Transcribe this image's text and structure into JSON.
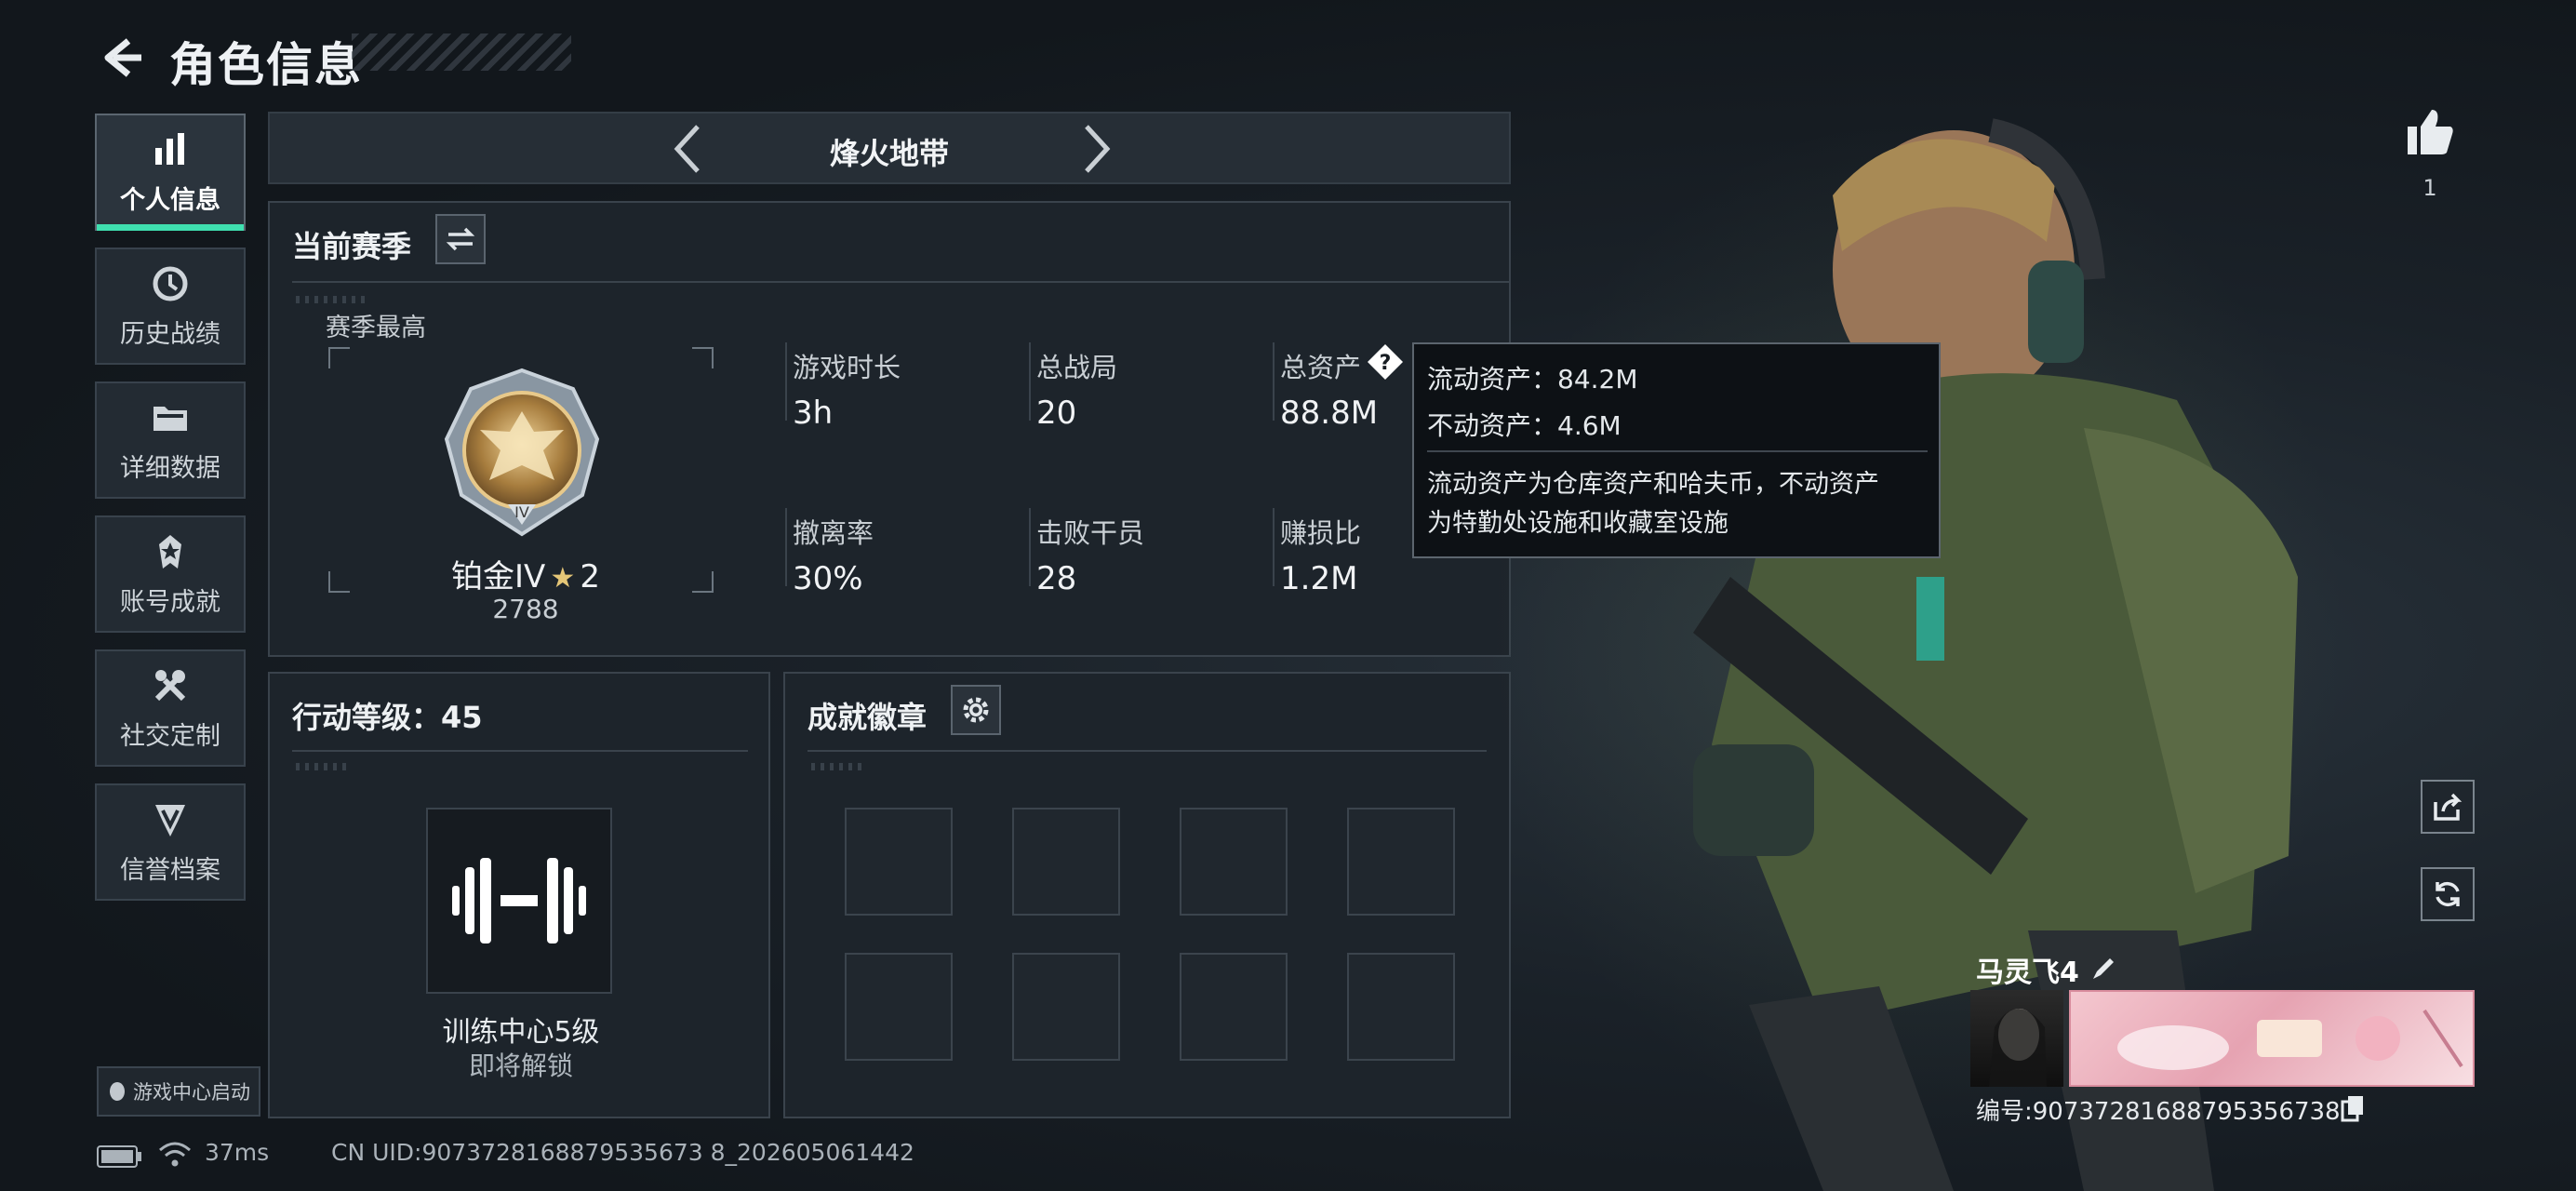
{
  "header": {
    "title": "角色信息"
  },
  "nav": [
    {
      "label": "个人信息",
      "icon": "bar-chart-icon",
      "active": true
    },
    {
      "label": "历史战绩",
      "icon": "history-icon"
    },
    {
      "label": "详细数据",
      "icon": "folder-icon"
    },
    {
      "label": "账号成就",
      "icon": "achievement-icon"
    },
    {
      "label": "社交定制",
      "icon": "tools-icon"
    },
    {
      "label": "信誉档案",
      "icon": "shield-icon"
    }
  ],
  "launch_button": "游戏中心启动",
  "status_bar": {
    "ping": "37ms",
    "uid": "CN UID:9073728168879535673 8_202605061442"
  },
  "map_selector": {
    "name": "烽火地带"
  },
  "season": {
    "title": "当前赛季",
    "best_label": "赛季最高",
    "rank_name": "铂金IV",
    "rank_stars": "2",
    "rank_score": "2788",
    "stats": [
      {
        "label": "游戏时长",
        "value": "3h"
      },
      {
        "label": "总战局",
        "value": "20"
      },
      {
        "label": "总资产",
        "value": "88.8M"
      },
      {
        "label": "撤离率",
        "value": "30%"
      },
      {
        "label": "击败干员",
        "value": "28"
      },
      {
        "label": "赚损比",
        "value": "1.2M"
      }
    ]
  },
  "tooltip": {
    "liquid": "流动资产：84.2M",
    "fixed": "不动资产：4.6M",
    "desc1": "流动资产为仓库资产和哈夫币，不动资产",
    "desc2": "为特勤处设施和收藏室设施"
  },
  "action_level": {
    "title": "行动等级：45",
    "training_title": "训练中心5级",
    "training_status": "即将解锁"
  },
  "badges": {
    "title": "成就徽章"
  },
  "likes": {
    "count": "1"
  },
  "player": {
    "name": "马灵飞4",
    "id_line": "编号:90737281688795356738"
  },
  "accent_color": "#3fe0b0"
}
